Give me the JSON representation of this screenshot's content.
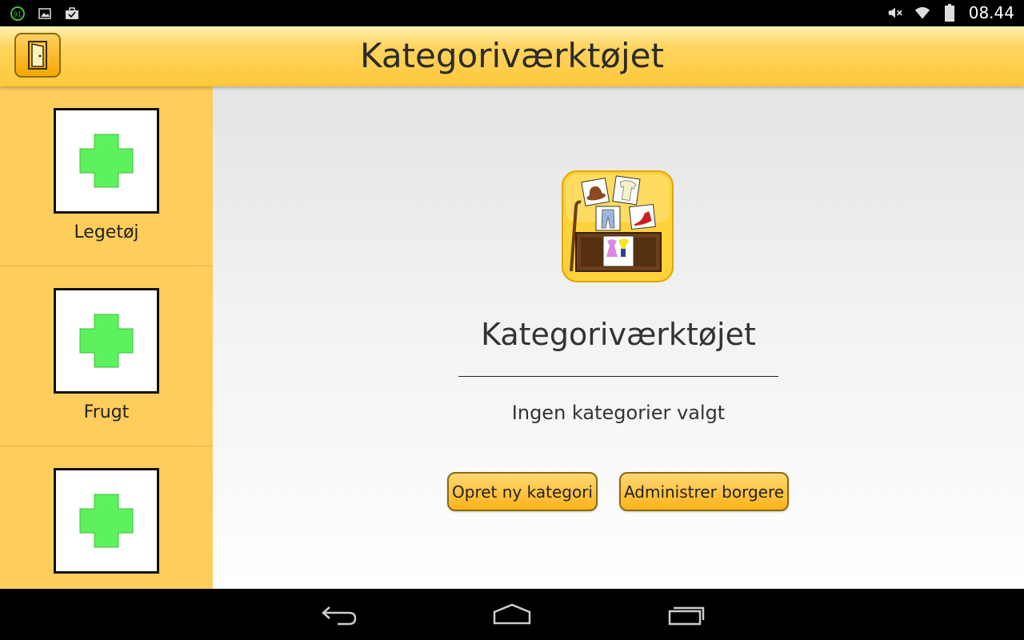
{
  "status_bar": {
    "notification_badge": "91",
    "time": "08.44",
    "icons": [
      "notification-badge-icon",
      "image-icon",
      "briefcase-icon",
      "mute-icon",
      "wifi-icon",
      "battery-icon"
    ]
  },
  "app_bar": {
    "title": "Kategoriværktøjet",
    "exit_icon": "door-icon"
  },
  "sidebar": {
    "items": [
      {
        "label": "Legetøj",
        "icon": "plus-icon"
      },
      {
        "label": "Frugt",
        "icon": "plus-icon"
      },
      {
        "label": "",
        "icon": "plus-icon"
      }
    ]
  },
  "main": {
    "logo_icon": "category-tool-logo-icon",
    "title": "Kategoriværktøjet",
    "empty_message": "Ingen kategorier valgt",
    "create_button": "Opret ny kategori",
    "admin_button": "Administrer borgere"
  },
  "nav_bar": {
    "icons": [
      "back-icon",
      "home-icon",
      "recents-icon"
    ]
  },
  "colors": {
    "accent": "#ffc83a",
    "sidebar": "#ffcd5c",
    "plus": "#5df25d"
  }
}
